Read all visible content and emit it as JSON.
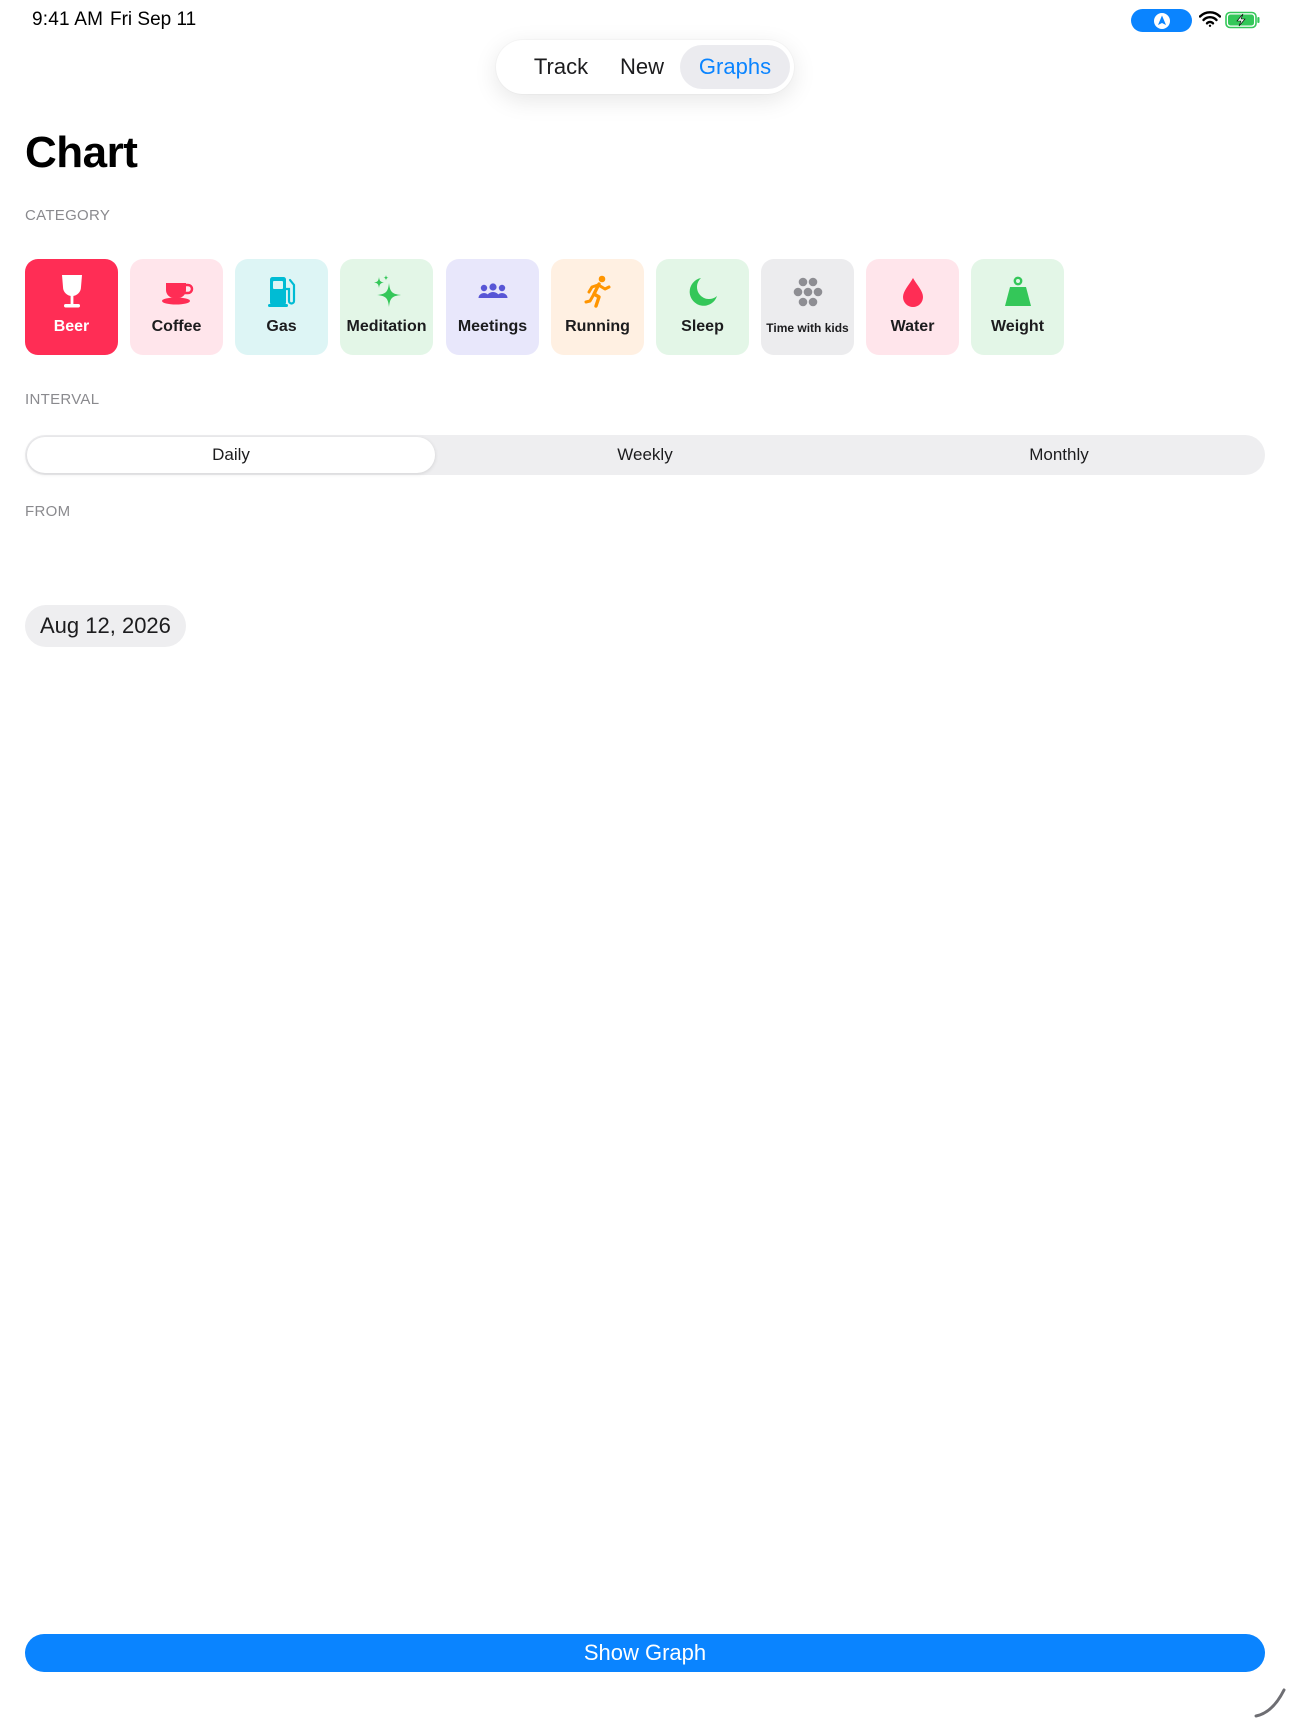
{
  "status_bar": {
    "time": "9:41 AM",
    "date": "Fri Sep 11"
  },
  "tabs": [
    {
      "label": "Track",
      "active": false
    },
    {
      "label": "New",
      "active": false
    },
    {
      "label": "Graphs",
      "active": true
    }
  ],
  "page_title": "Chart",
  "category": {
    "label": "CATEGORY",
    "selected": "Beer",
    "items": [
      {
        "label": "Beer",
        "icon": "wine-glass-icon",
        "color": "#ff2d55",
        "selected": true
      },
      {
        "label": "Coffee",
        "icon": "coffee-cup-icon",
        "color": "#ff2d55"
      },
      {
        "label": "Gas",
        "icon": "fuel-pump-icon",
        "color": "#00c7be"
      },
      {
        "label": "Meditation",
        "icon": "sparkles-icon",
        "color": "#34c759"
      },
      {
        "label": "Meetings",
        "icon": "people-icon",
        "color": "#5856d6"
      },
      {
        "label": "Running",
        "icon": "running-figure-icon",
        "color": "#ff9500"
      },
      {
        "label": "Sleep",
        "icon": "moon-icon",
        "color": "#34c759"
      },
      {
        "label": "Time with kids",
        "icon": "circles-cluster-icon",
        "color": "#8e8e93"
      },
      {
        "label": "Water",
        "icon": "drop-icon",
        "color": "#ff2d55"
      },
      {
        "label": "Weight",
        "icon": "kettlebell-icon",
        "color": "#34c759"
      }
    ]
  },
  "interval": {
    "label": "INTERVAL",
    "options": [
      "Daily",
      "Weekly",
      "Monthly"
    ],
    "selected": "Daily"
  },
  "from": {
    "label": "FROM",
    "date": "Aug 12, 2026"
  },
  "show_graph_label": "Show Graph",
  "colors": {
    "accent": "#0a84ff",
    "selected_tile": "#ff2d55"
  }
}
